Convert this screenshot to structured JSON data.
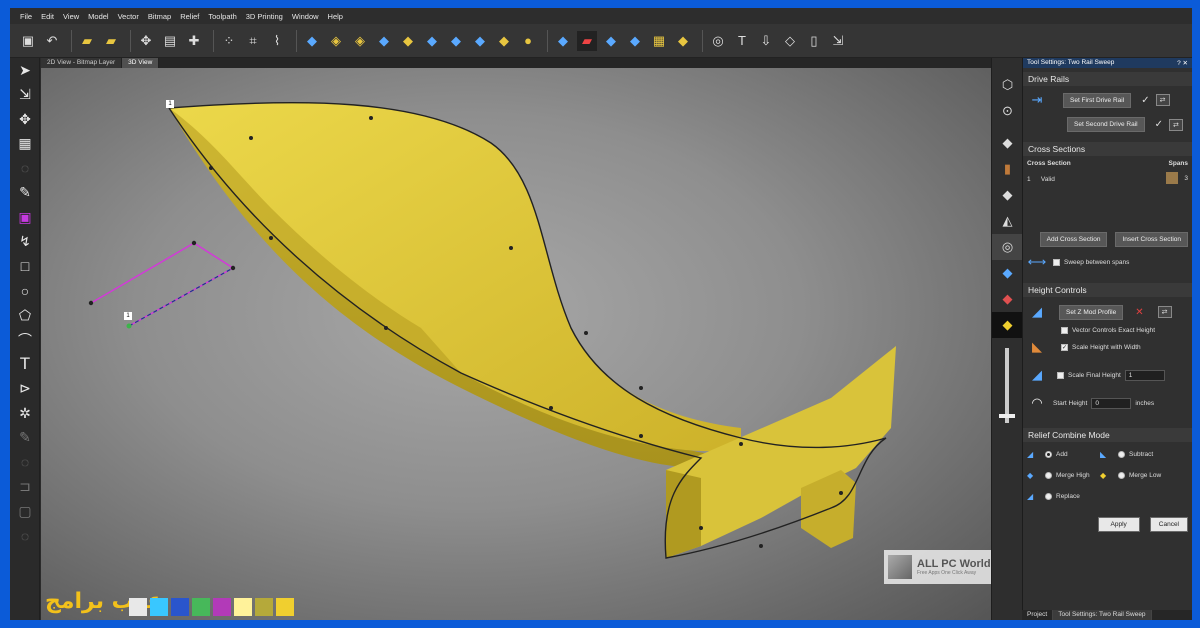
{
  "menu": [
    "File",
    "Edit",
    "View",
    "Model",
    "Vector",
    "Bitmap",
    "Relief",
    "Toolpath",
    "3D Printing",
    "Window",
    "Help"
  ],
  "view_tabs": [
    "2D View - Bitmap Layer",
    "3D View"
  ],
  "panel": {
    "title": "Tool Settings: Two Rail Sweep",
    "title_controls": "? ✕",
    "drive_rails": {
      "heading": "Drive Rails",
      "first_button": "Set First Drive Rail",
      "second_button": "Set Second Drive Rail"
    },
    "cross_sections": {
      "heading": "Cross Sections",
      "col_section": "Cross Section",
      "col_spans": "Spans",
      "row_index": "1",
      "row_status": "Valid",
      "row_spans": "3",
      "add_button": "Add Cross Section",
      "insert_button": "Insert Cross Section",
      "sweep_between": "Sweep between spans"
    },
    "height_controls": {
      "heading": "Height Controls",
      "z_mod_button": "Set Z Mod Profile",
      "vector_exact": "Vector Controls Exact Height",
      "scale_width": "Scale Height with Width",
      "scale_final": "Scale Final Height",
      "scale_final_value": "1",
      "start_height": "Start Height",
      "start_height_value": "0",
      "start_height_unit": "inches"
    },
    "relief_combine": {
      "heading": "Relief Combine Mode",
      "add": "Add",
      "subtract": "Subtract",
      "merge_high": "Merge High",
      "merge_low": "Merge Low",
      "replace": "Replace"
    },
    "apply_button": "Apply",
    "cancel_button": "Cancel"
  },
  "bottom_tabs": [
    "Project",
    "Tool Settings: Two Rail Sweep"
  ],
  "watermark": {
    "title": "ALL PC World",
    "subtitle": "Free Apps One Click Away"
  },
  "branding": {
    "arabic_text": "عرب برامج"
  },
  "rail_labels": {
    "start_marker": "1",
    "section_marker": "1"
  },
  "colors": {
    "accent": "#5aa9ff",
    "model_yellow": "#d8c236",
    "vector_magenta": "#d23ad8",
    "swatches": [
      "#e8e8e8",
      "#39c7ff",
      "#2a55cc",
      "#47b85a",
      "#b23ab8",
      "#fff29a",
      "#b5a93a",
      "#f0cf2f"
    ]
  }
}
